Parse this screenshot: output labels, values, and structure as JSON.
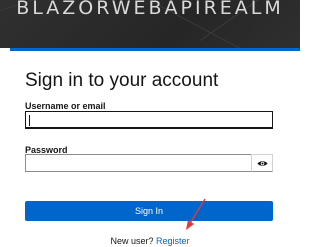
{
  "header": {
    "realm_name": "BLAZORWEBAPIREALM"
  },
  "login": {
    "title": "Sign in to your account",
    "username_label": "Username or email",
    "username_value": "",
    "password_label": "Password",
    "password_value": "",
    "signin_label": "Sign In",
    "new_user_text": "New user?",
    "register_link": "Register"
  },
  "colors": {
    "header_bg": "#2c2c2c",
    "accent": "#0066cc",
    "annotation": "#e53935"
  },
  "icons": {
    "password_toggle": "eye-icon"
  }
}
